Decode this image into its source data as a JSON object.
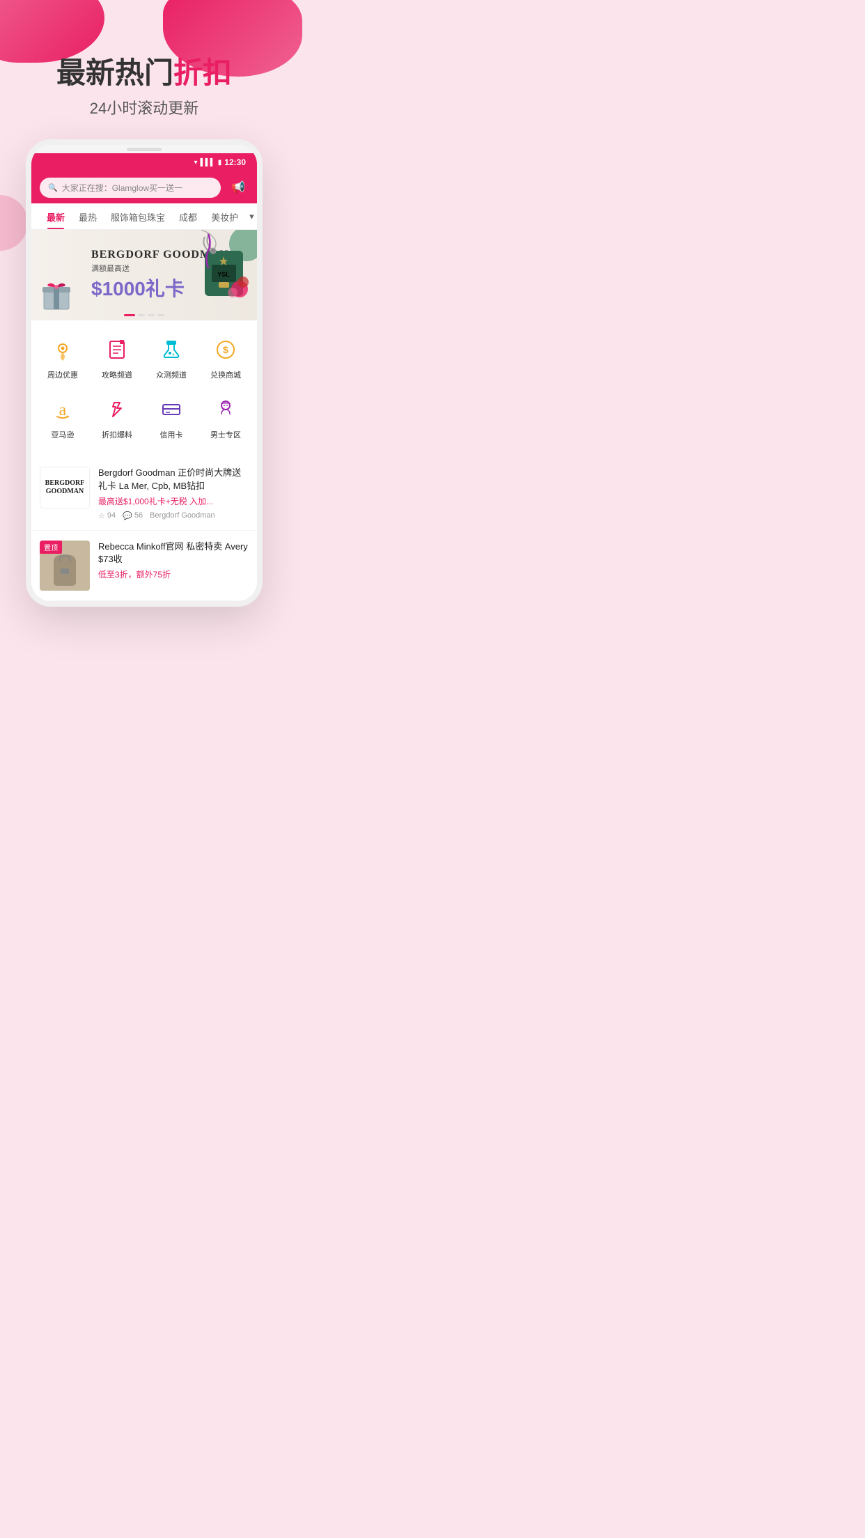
{
  "background": {
    "color": "#fce4ec"
  },
  "hero": {
    "title_part1": "最新热门",
    "title_part2": "折扣",
    "subtitle": "24小时滚动更新"
  },
  "status_bar": {
    "time": "12:30",
    "wifi_icon": "▾",
    "signal_icon": "▌",
    "battery_icon": "▮"
  },
  "search_bar": {
    "placeholder": "大家正在搜：Glamglow买一送一",
    "search_icon": "🔍",
    "megaphone_icon": "📢"
  },
  "tabs": [
    {
      "label": "最新",
      "active": true
    },
    {
      "label": "最热",
      "active": false
    },
    {
      "label": "服饰箱包珠宝",
      "active": false
    },
    {
      "label": "成都",
      "active": false
    },
    {
      "label": "美妆护",
      "active": false
    }
  ],
  "banner": {
    "brand_name": "BERGDORF GOODMAN",
    "subtitle": "满额最高送",
    "amount": "$1000礼卡",
    "dots": [
      true,
      false,
      false,
      false
    ]
  },
  "icon_grid": [
    {
      "icon": "📍",
      "label": "周边优惠",
      "color": "#f5a623"
    },
    {
      "icon": "📋",
      "label": "攻略频道",
      "color": "#e91e63"
    },
    {
      "icon": "🔬",
      "label": "众测频道",
      "color": "#00bcd4"
    },
    {
      "icon": "💰",
      "label": "兑换商城",
      "color": "#f5a623"
    },
    {
      "icon": "🅐",
      "label": "亚马逊",
      "color": "#f5a623"
    },
    {
      "icon": "📢",
      "label": "折扣爆料",
      "color": "#e91e63"
    },
    {
      "icon": "💳",
      "label": "信用卡",
      "color": "#673ab7"
    },
    {
      "icon": "👤",
      "label": "男士专区",
      "color": "#9c27b0"
    }
  ],
  "deals": [
    {
      "logo_line1": "BERGDORF",
      "logo_line2": "GOODMAN",
      "title": "Bergdorf Goodman 正价时尚大牌送礼卡 La Mer, Cpb, MB钻扣",
      "price": "最高送$1,000礼卡+无税 入加...",
      "stars": "94",
      "comments": "56",
      "source": "Bergdorf Goodman"
    },
    {
      "badge": "置顶",
      "title": "Rebecca Minkoff官网 私密特卖 Avery $73收",
      "price": "低至3折，额外75折"
    }
  ]
}
